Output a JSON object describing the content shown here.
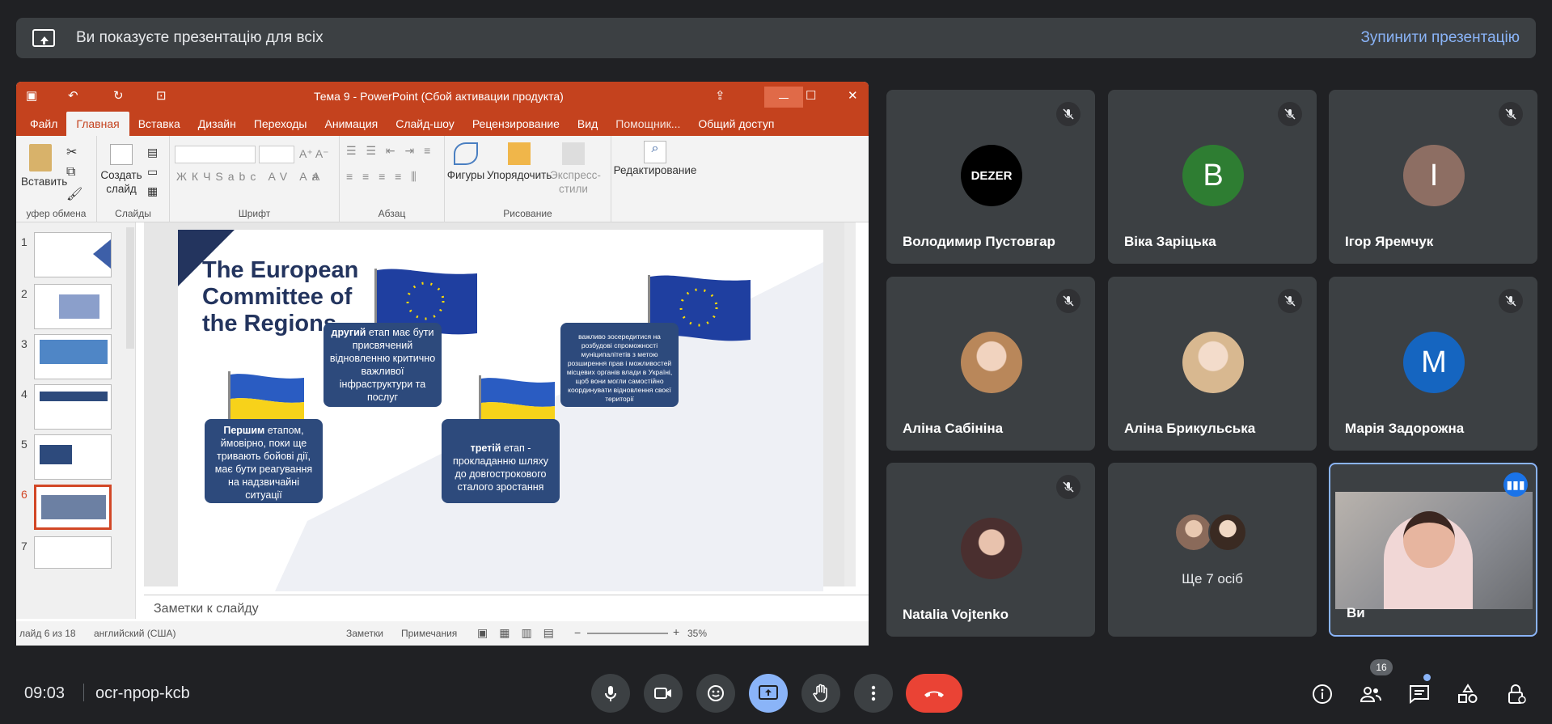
{
  "banner": {
    "text": "Ви показуєте презентацію для всіх",
    "stop": "Зупинити презентацію"
  },
  "ppt": {
    "title": "Тема 9 - PowerPoint (Сбой активации продукта)",
    "tabs": [
      "Файл",
      "Главная",
      "Вставка",
      "Дизайн",
      "Переходы",
      "Анимация",
      "Слайд-шоу",
      "Рецензирование",
      "Вид",
      "Помощник...",
      "Общий доступ"
    ],
    "ribbon": {
      "paste": "Вставить",
      "new_slide": "Создать слайд",
      "shapes": "Фигуры",
      "arrange": "Упорядочить",
      "express": "Экспресс-стили",
      "editing": "Редактирование",
      "groups": [
        "уфер обмена",
        "Слайды",
        "Шрифт",
        "Абзац",
        "Рисование"
      ]
    },
    "thumb_numbers": [
      "1",
      "2",
      "3",
      "4",
      "5",
      "6",
      "7"
    ],
    "notes": "Заметки к слайду",
    "status": {
      "slide": "лайд 6 из 18",
      "lang": "английский (США)",
      "notes": "Заметки",
      "comments": "Примечания",
      "zoom": "35%"
    }
  },
  "slide": {
    "title": "The European Committee of the Regions",
    "box1_bold": "Першим",
    "box1": " етапом, ймовірно, поки ще тривають бойові дії, має бути реагування на надзвичайні ситуації",
    "box2_bold": "другий",
    "box2": " етап має бути присвячений відновленню критично важливої інфраструктури та послуг",
    "box3_bold": "третій",
    "box3": " етап - прокладанню шляху до довгострокового сталого зростання",
    "box4": "важливо зосередитися на розбудові спроможності муніципалітетів з метою розширення прав і можливостей місцевих органів влади в Україні, щоб вони могли самостійно координувати відновлення своєї території"
  },
  "participants": [
    {
      "name": "Володимир Пустовгар",
      "avatar": "DEZER",
      "color": "#000000"
    },
    {
      "name": "Віка Заріцька",
      "avatar": "B",
      "color": "#2e7d32"
    },
    {
      "name": "Ігор Яремчук",
      "avatar": "I",
      "color": "#8d6e63"
    },
    {
      "name": "Аліна Сабініна",
      "avatar": "photo",
      "color": "#c9a48c"
    },
    {
      "name": "Аліна Брикульська",
      "avatar": "photo",
      "color": "#d8c0a8"
    },
    {
      "name": "Марія Задорожна",
      "avatar": "M",
      "color": "#1565c0"
    },
    {
      "name": "Natalia Vojtenko",
      "avatar": "photo",
      "color": "#5a3b3b"
    },
    {
      "name": "Ще 7 осіб",
      "avatar": "group",
      "color": "#8a6a5a"
    },
    {
      "name": "Ви",
      "avatar": "video",
      "color": "#9aa0a6"
    }
  ],
  "bottom": {
    "time": "09:03",
    "code": "ocr-npop-kcb",
    "people_count": "16"
  },
  "colors": {
    "accent": "#8ab4f8",
    "ppt": "#c4421e",
    "hangup": "#ea4335",
    "present": "#8ab4f8"
  }
}
